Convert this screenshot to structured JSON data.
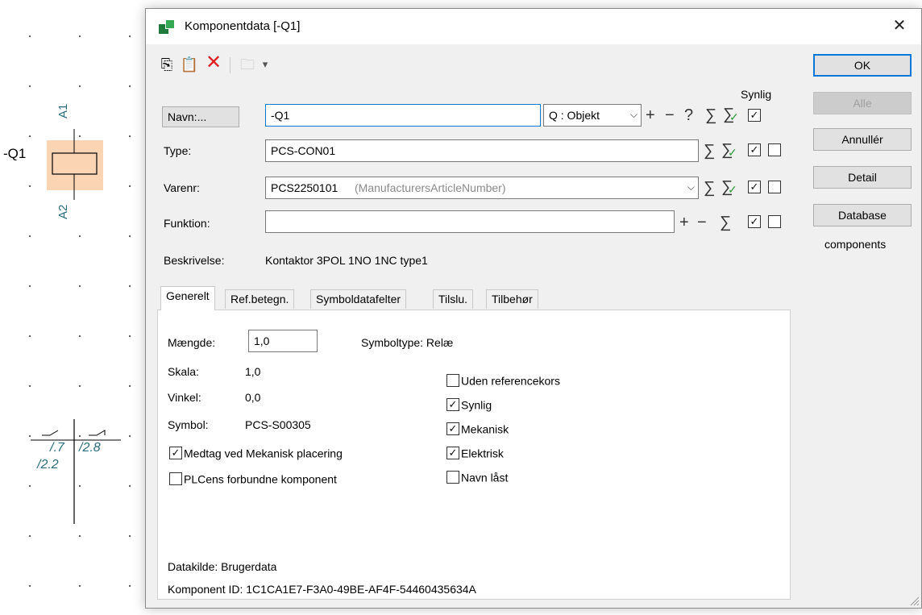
{
  "cad": {
    "component_ref": "-Q1",
    "pin_top": "A1",
    "pin_bottom": "A2",
    "contact_ref1": "/.7",
    "contact_ref2": "/2.8",
    "contact_ref3": "/2.2"
  },
  "dialog": {
    "title": "Komponentdata [-Q1]",
    "close_glyph": "✕",
    "toolbar": {
      "copy": "⎘",
      "paste": "📋",
      "delete": "✕",
      "folder": "🗀",
      "dropdown": "▾"
    },
    "synlig_header": "Synlig",
    "name_button": "Navn:...",
    "name_value": "-Q1",
    "object_select": "Q : Objekt",
    "object_select_arrow": "⌵",
    "type_label": "Type:",
    "type_value": "PCS-CON01",
    "varenr_label": "Varenr:",
    "varenr_value": "PCS2250101",
    "varenr_hint": "(ManufacturersArticleNumber)",
    "varenr_arrow": "⌵",
    "funktion_label": "Funktion:",
    "funktion_value": "",
    "beskrivelse_label": "Beskrivelse:",
    "beskrivelse_value": "Kontaktor 3POL 1NO 1NC type1",
    "symbols": {
      "plus": "+",
      "minus": "−",
      "question": "?",
      "sigma": "∑"
    },
    "buttons": {
      "ok": "OK",
      "alle": "Alle",
      "annuller": "Annullér",
      "detail": "Detail",
      "database": "Database",
      "components_label": "components"
    },
    "tabs": [
      "Generelt",
      "Ref.betegn.",
      "Symboldatafelter",
      "Tilslu.",
      "Tilbehør"
    ],
    "general": {
      "maengde_label": "Mængde:",
      "maengde_value": "1,0",
      "symboltype": "Symboltype: Relæ",
      "skala_label": "Skala:",
      "skala_value": "1,0",
      "vinkel_label": "Vinkel:",
      "vinkel_value": "0,0",
      "symbol_label": "Symbol:",
      "symbol_value": "PCS-S00305",
      "medtag": "Medtag ved Mekanisk placering",
      "plcens": "PLCens forbundne komponent",
      "uden": "Uden referencekors",
      "synlig": "Synlig",
      "mekanisk": "Mekanisk",
      "elektrisk": "Elektrisk",
      "navn_laast": "Navn låst",
      "datakilde": "Datakilde: Brugerdata",
      "komponent_id": "Komponent ID: 1C1CA1E7-F3A0-49BE-AF4F-54460435634A"
    },
    "checkmark": "✓"
  }
}
